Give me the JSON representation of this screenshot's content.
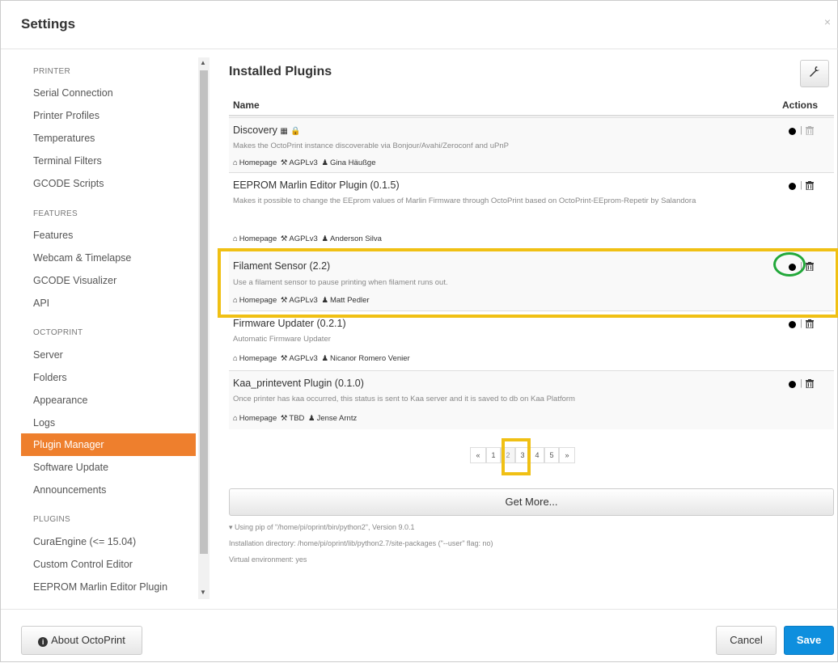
{
  "modal": {
    "title": "Settings",
    "close": "×"
  },
  "sidebar": {
    "sections": [
      {
        "title": "PRINTER",
        "items": [
          "Serial Connection",
          "Printer Profiles",
          "Temperatures",
          "Terminal Filters",
          "GCODE Scripts"
        ]
      },
      {
        "title": "FEATURES",
        "items": [
          "Features",
          "Webcam & Timelapse",
          "GCODE Visualizer",
          "API"
        ]
      },
      {
        "title": "OCTOPRINT",
        "items": [
          "Server",
          "Folders",
          "Appearance",
          "Logs",
          "Plugin Manager",
          "Software Update",
          "Announcements"
        ]
      },
      {
        "title": "PLUGINS",
        "items": [
          "CuraEngine (<= 15.04)",
          "Custom Control Editor",
          "EEPROM Marlin Editor Plugin"
        ]
      }
    ],
    "active_item": "Plugin Manager"
  },
  "main": {
    "heading": "Installed Plugins",
    "table": {
      "col_name": "Name",
      "col_actions": "Actions"
    },
    "plugins": [
      {
        "name": "Discovery",
        "desc": "Makes the OctoPrint instance discoverable via Bonjour/Avahi/Zeroconf and uPnP",
        "homepage": "Homepage",
        "license": "AGPLv3",
        "author": "Gina Häußge",
        "trash_disabled": true
      },
      {
        "name": "EEPROM Marlin Editor Plugin (0.1.5)",
        "desc": "Makes it possible to change the EEprom values of Marlin Firmware through OctoPrint based on OctoPrint-EEprom-Repetir by Salandora",
        "homepage": "Homepage",
        "license": "AGPLv3",
        "author": "Anderson Silva",
        "trash_disabled": false
      },
      {
        "name": "Filament Sensor (2.2)",
        "desc": "Use a filament sensor to pause printing when filament runs out.",
        "homepage": "Homepage",
        "license": "AGPLv3",
        "author": "Matt Pedler",
        "trash_disabled": false
      },
      {
        "name": "Firmware Updater (0.2.1)",
        "desc": "Automatic Firmware Updater",
        "homepage": "Homepage",
        "license": "AGPLv3",
        "author": "Nicanor Romero Venier",
        "trash_disabled": false
      },
      {
        "name": "Kaa_printevent Plugin (0.1.0)",
        "desc": "Once printer has kaa occurred, this status is sent to Kaa server and it is saved to db on Kaa Platform",
        "homepage": "Homepage",
        "license": "TBD",
        "author": "Jense Arntz",
        "trash_disabled": false
      }
    ],
    "pagination": {
      "prev": "«",
      "pages": [
        "1",
        "2",
        "3",
        "4",
        "5"
      ],
      "next": "»",
      "current": "2"
    },
    "get_more": "Get More...",
    "footer_lines": [
      "▾ Using pip of \"/home/pi/oprint/bin/python2\", Version 9.0.1",
      "Installation directory: /home/pi/oprint/lib/python2.7/site-packages (\"--user\" flag: no)",
      "Virtual environment: yes"
    ]
  },
  "footer": {
    "about": "About OctoPrint",
    "cancel": "Cancel",
    "save": "Save"
  },
  "colors": {
    "accent": "#ee7f2d",
    "primary": "#0e8fde",
    "highlight": "#f0c014",
    "circle": "#22a83a"
  },
  "icons": {
    "close": "close-icon",
    "wrench": "wrench-icon",
    "homepage": "home-icon",
    "license": "gavel-icon",
    "author": "user-icon",
    "trash": "trash-icon",
    "toggle": "toggle-dot-icon",
    "info": "info-icon",
    "lock": "lock-icon",
    "grid": "grid-icon"
  }
}
